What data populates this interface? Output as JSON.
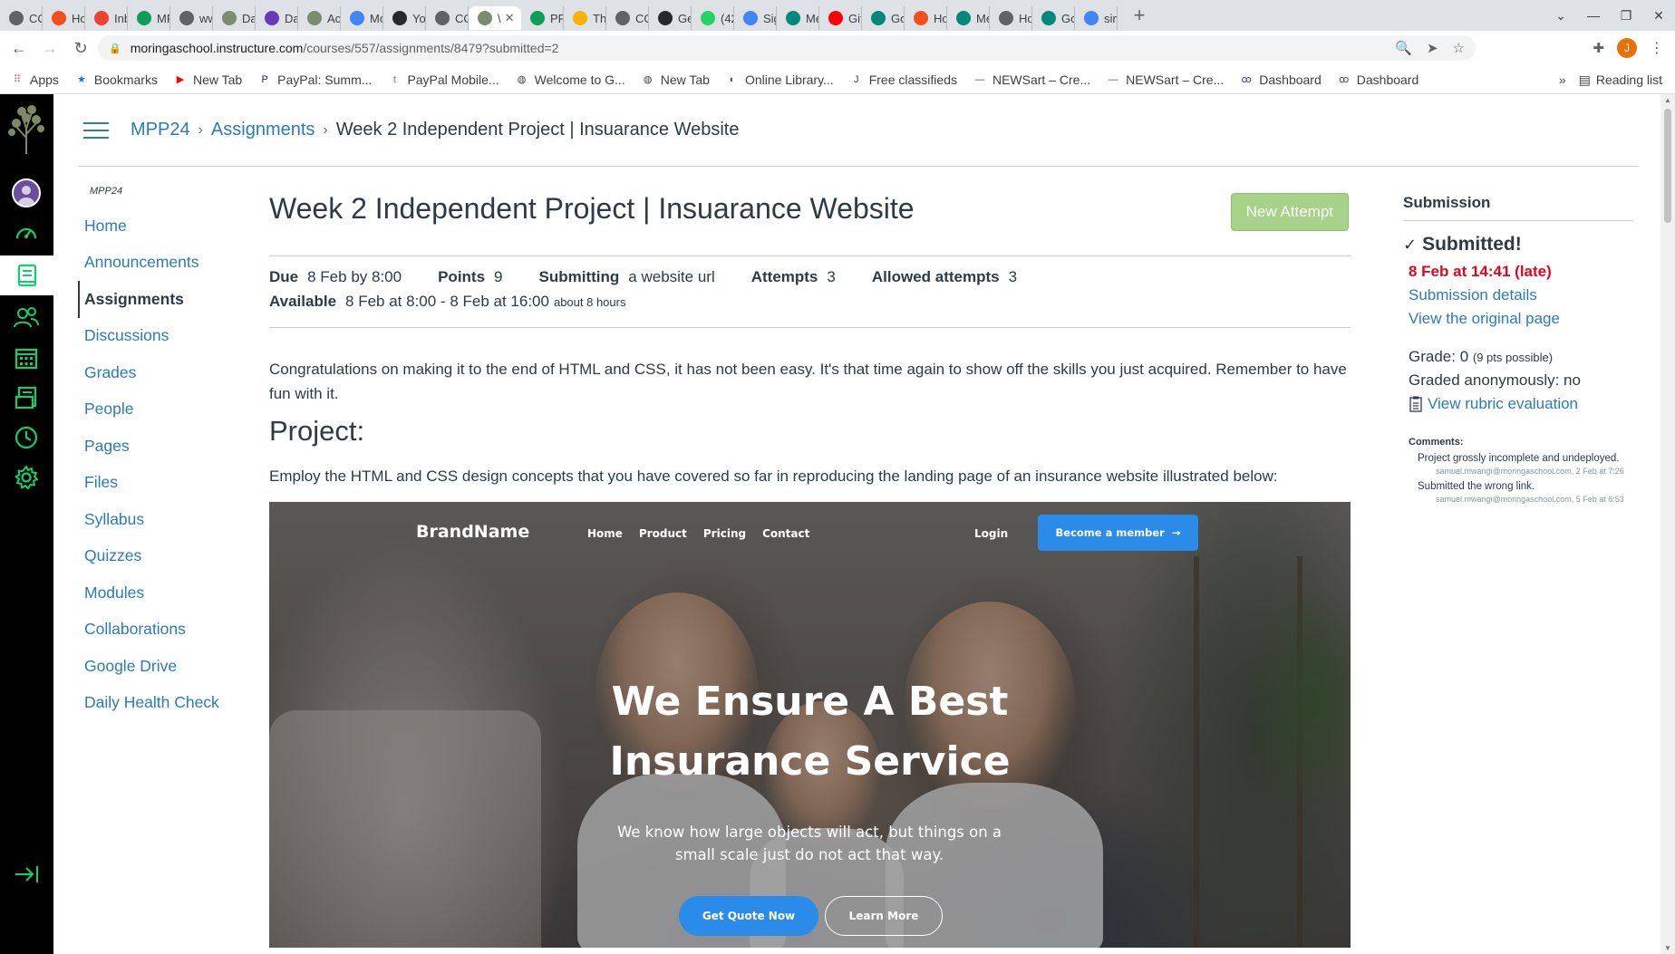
{
  "browser": {
    "tabs": [
      {
        "label": "CO",
        "icon": "globe-icon",
        "color": "#5f6368"
      },
      {
        "label": "Ho",
        "icon": "figma-icon",
        "color": "#f24e1e"
      },
      {
        "label": "Inb",
        "icon": "gmail-icon",
        "color": "#ea4335"
      },
      {
        "label": "MP",
        "icon": "sheets-icon",
        "color": "#0f9d58"
      },
      {
        "label": "ww",
        "icon": "globe-icon",
        "color": "#5f6368"
      },
      {
        "label": "Dai",
        "icon": "tree-icon",
        "color": "#7c8c6e"
      },
      {
        "label": "Dai",
        "icon": "forms-icon",
        "color": "#673ab7"
      },
      {
        "label": "Acc",
        "icon": "tree-icon",
        "color": "#7c8c6e"
      },
      {
        "label": "Mo",
        "icon": "calendar-icon",
        "color": "#4285f4"
      },
      {
        "label": "You",
        "icon": "github-icon",
        "color": "#24292e"
      },
      {
        "label": "CO",
        "icon": "globe-icon",
        "color": "#5f6368"
      },
      {
        "label": "\\",
        "icon": "tree-icon",
        "color": "#7c8c6e"
      },
      {
        "label": "PRO",
        "icon": "sheets-icon",
        "color": "#0f9d58"
      },
      {
        "label": "The",
        "icon": "slides-icon",
        "color": "#f4b400"
      },
      {
        "label": "CO",
        "icon": "globe-icon",
        "color": "#5f6368"
      },
      {
        "label": "Ger",
        "icon": "github-icon",
        "color": "#24292e"
      },
      {
        "label": "(42",
        "icon": "whatsapp-icon",
        "color": "#25d366"
      },
      {
        "label": "Sig",
        "icon": "google-icon",
        "color": "#4285f4"
      },
      {
        "label": "Me",
        "icon": "meet-icon",
        "color": "#00897b"
      },
      {
        "label": "Git",
        "icon": "youtube-icon",
        "color": "#ff0000"
      },
      {
        "label": "Goo",
        "icon": "meet-icon",
        "color": "#00897b"
      },
      {
        "label": "Ho",
        "icon": "figma-icon",
        "color": "#f24e1e"
      },
      {
        "label": "Me",
        "icon": "meet-icon",
        "color": "#00897b"
      },
      {
        "label": "Ho",
        "icon": "home-icon",
        "color": "#5f6368"
      },
      {
        "label": "Goo",
        "icon": "meet-icon",
        "color": "#00897b"
      },
      {
        "label": "sim",
        "icon": "google-icon",
        "color": "#4285f4"
      }
    ],
    "active_tab_index": 11,
    "url_host": "moringaschool.instructure.com",
    "url_path": "/courses/557/assignments/8479?submitted=2",
    "profile_initial": "J",
    "bookmarks": [
      {
        "label": "Apps",
        "icon": "apps-grid-icon"
      },
      {
        "label": "Bookmarks",
        "icon": "star-icon"
      },
      {
        "label": "New Tab",
        "icon": "youtube-icon"
      },
      {
        "label": "PayPal: Summ...",
        "icon": "paypal-icon"
      },
      {
        "label": "PayPal Mobile...",
        "icon": "plant-icon"
      },
      {
        "label": "Welcome to G...",
        "icon": "globe-icon"
      },
      {
        "label": "New Tab",
        "icon": "globe-icon"
      },
      {
        "label": "Online Library...",
        "icon": "library-icon"
      },
      {
        "label": "Free classifieds",
        "icon": "jiji-icon"
      },
      {
        "label": "NEWSart – Cre...",
        "icon": "newsart-icon"
      },
      {
        "label": "NEWSart – Cre...",
        "icon": "newsart-icon"
      },
      {
        "label": "Dashboard",
        "icon": "dashboard-icon"
      },
      {
        "label": "Dashboard",
        "icon": "dashboard-icon"
      }
    ],
    "reading_list": "Reading list"
  },
  "breadcrumb": {
    "course": "MPP24",
    "section": "Assignments",
    "current": "Week 2 Independent Project | Insuarance Website"
  },
  "course_nav": {
    "title": "MPP24",
    "items": [
      "Home",
      "Announcements",
      "Assignments",
      "Discussions",
      "Grades",
      "People",
      "Pages",
      "Files",
      "Syllabus",
      "Quizzes",
      "Modules",
      "Collaborations",
      "Google Drive",
      "Daily Health Check"
    ],
    "active": "Assignments"
  },
  "assignment": {
    "title": "Week 2 Independent Project | Insuarance Website",
    "new_attempt_label": "New Attempt",
    "due_label": "Due",
    "due_value": "8 Feb by 8:00",
    "points_label": "Points",
    "points_value": "9",
    "submitting_label": "Submitting",
    "submitting_value": "a website url",
    "attempts_label": "Attempts",
    "attempts_value": "3",
    "allowed_label": "Allowed attempts",
    "allowed_value": "3",
    "available_label": "Available",
    "available_value": "8 Feb at 8:00 - 8 Feb at 16:00",
    "available_note": "about 8 hours",
    "description": "Congratulations on making it to the end of HTML and CSS, it has not been easy. It's that time again to show off the skills you just acquired. Remember to have fun with it.",
    "project_heading": "Project:",
    "employ_text": "Employ the HTML and CSS design concepts that you have covered so far in reproducing the landing page of an insurance website illustrated below:"
  },
  "hero": {
    "brand": "BrandName",
    "nav": [
      "Home",
      "Product",
      "Pricing",
      "Contact"
    ],
    "login": "Login",
    "member_button": "Become a member",
    "headline_1": "We Ensure A Best",
    "headline_2": "Insurance Service",
    "subtext_1": "We know how large objects will act, but things on a",
    "subtext_2": "small scale just do not act that way.",
    "quote_button": "Get Quote Now",
    "learn_button": "Learn More"
  },
  "submission": {
    "heading": "Submission",
    "status": "Submitted!",
    "submitted_at": "8 Feb at 14:41 (late)",
    "details_link": "Submission details",
    "original_link": "View the original page",
    "grade_label": "Grade: 0",
    "grade_note": "(9 pts possible)",
    "anonymous": "Graded anonymously: no",
    "rubric_link": "View rubric evaluation",
    "comments_label": "Comments:",
    "comments": [
      {
        "text": "Project grossly incomplete and undeployed.",
        "meta": "samuel.mwangi@moringaschool.com, 2 Feb at 7:26"
      },
      {
        "text": "Submitted the wrong link.",
        "meta": "samuel.mwangi@moringaschool.com, 5 Feb at 6:53"
      }
    ]
  },
  "colors": {
    "link": "#2b7abc",
    "canvas_nav_bg": "#000000",
    "canvas_nav_icon": "#0ed06e",
    "late": "#e0061f",
    "new_attempt_bg": "#a7d389",
    "hero_button": "#2a8be8"
  }
}
